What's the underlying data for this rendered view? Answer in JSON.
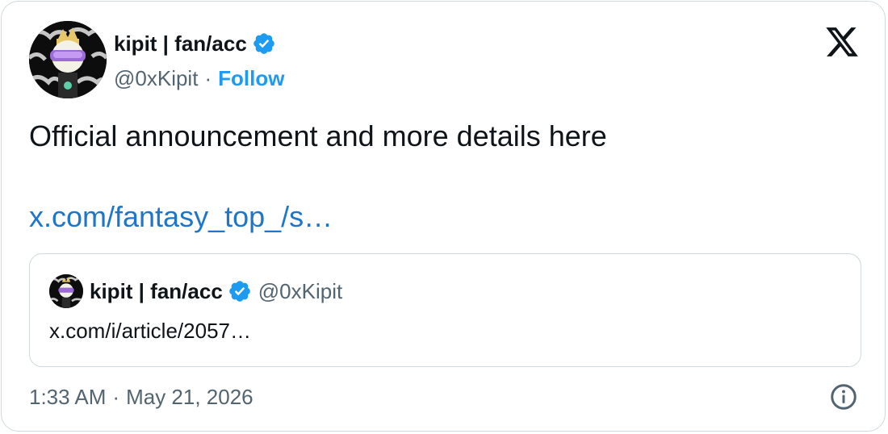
{
  "author": {
    "name": "kipit | fan/acc",
    "handle": "@0xKipit",
    "separator": "·",
    "follow_label": "Follow",
    "verified": true
  },
  "icons": {
    "brand": "x-logo-icon",
    "verified": "verified-badge-icon",
    "info": "info-icon"
  },
  "tweet": {
    "text": "Official announcement and more details here",
    "link_text": "x.com/fantasy_top_/s…"
  },
  "quoted": {
    "name": "kipit | fan/acc",
    "handle": "@0xKipit",
    "text": "x.com/i/article/2057…"
  },
  "footer": {
    "time": "1:33 AM",
    "separator": "·",
    "date": "May 21, 2026"
  },
  "colors": {
    "accent": "#1d9bf0",
    "link": "#1d76c9",
    "text": "#0f1419",
    "muted": "#536471",
    "border": "#cfd9de"
  }
}
